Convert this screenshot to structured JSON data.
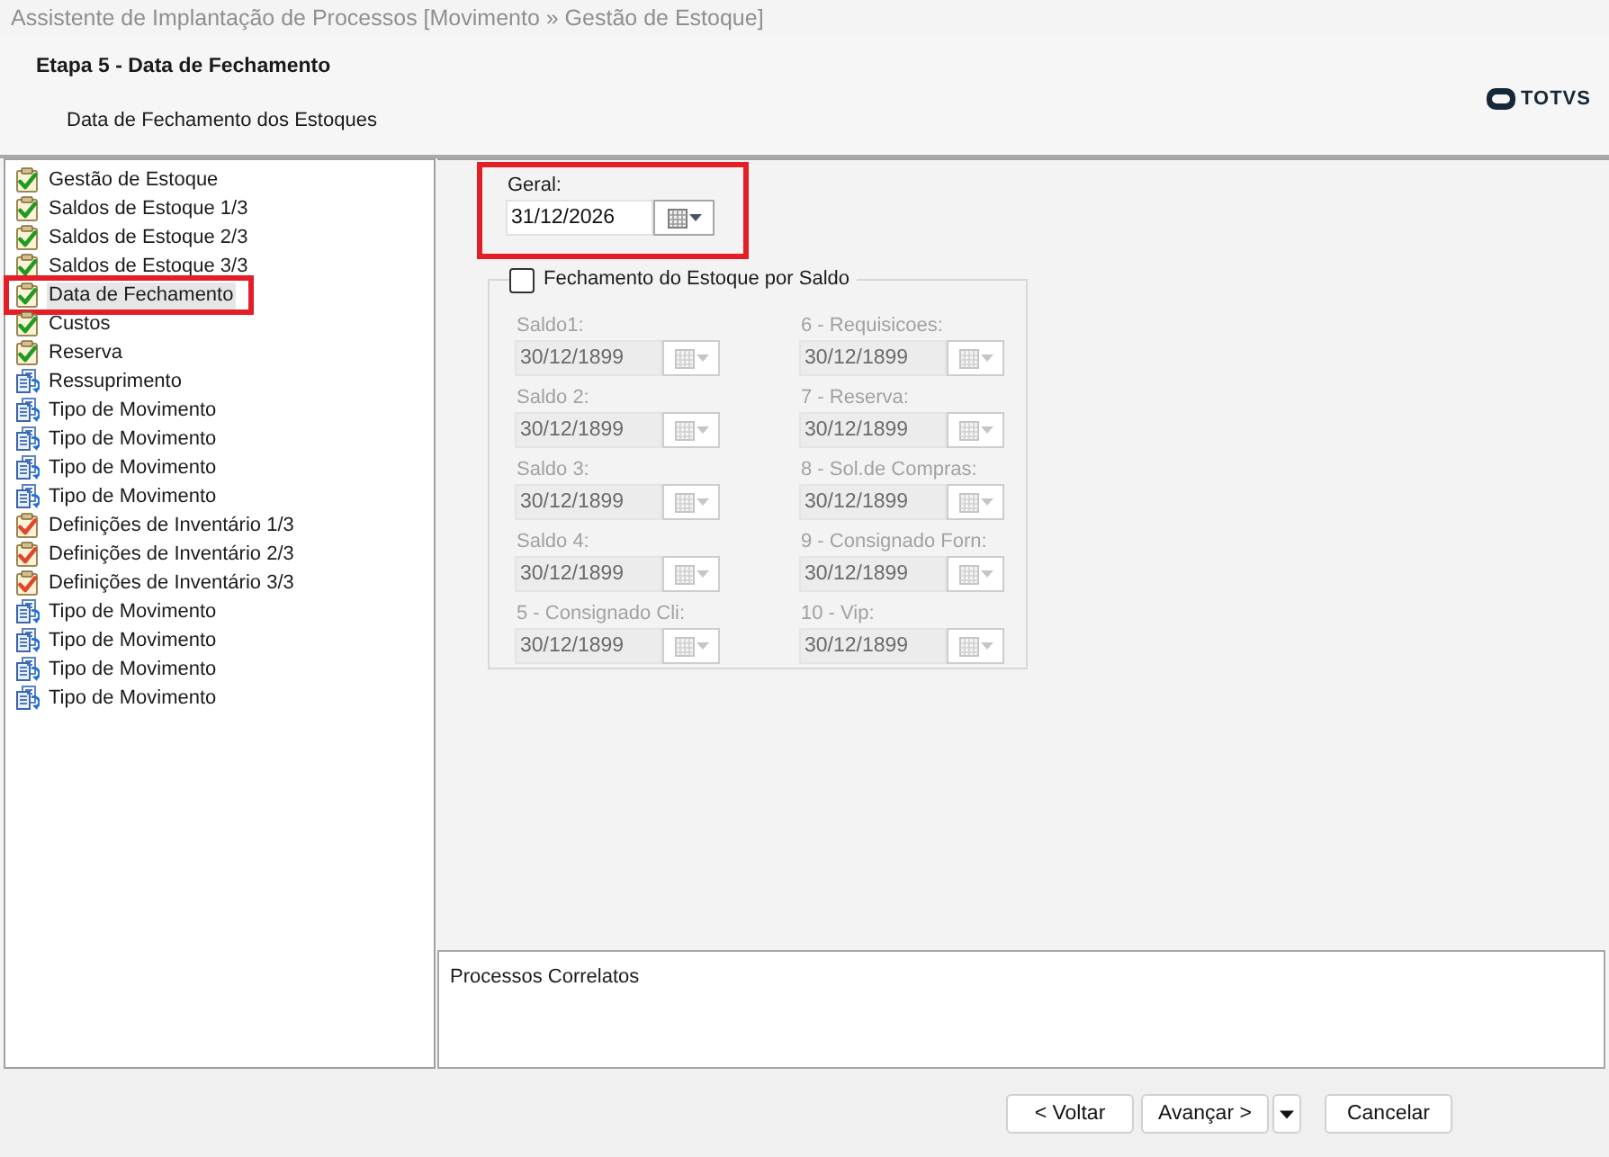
{
  "window": {
    "title": "Assistente de Implantação de Processos [Movimento » Gestão de Estoque]"
  },
  "header": {
    "step_title": "Etapa 5 - Data de Fechamento",
    "subtitle": "Data de Fechamento dos Estoques",
    "logo_text": "TOTVS"
  },
  "steps": [
    {
      "label": "Gestão de Estoque",
      "kind": "done",
      "selected": false,
      "marked": false
    },
    {
      "label": "Saldos de Estoque 1/3",
      "kind": "done",
      "selected": false,
      "marked": false
    },
    {
      "label": "Saldos de Estoque 2/3",
      "kind": "done",
      "selected": false,
      "marked": false
    },
    {
      "label": "Saldos de Estoque 3/3",
      "kind": "done",
      "selected": false,
      "marked": false
    },
    {
      "label": "Data de Fechamento",
      "kind": "done",
      "selected": true,
      "marked": true
    },
    {
      "label": "Custos",
      "kind": "done",
      "selected": false,
      "marked": false
    },
    {
      "label": "Reserva",
      "kind": "done",
      "selected": false,
      "marked": false
    },
    {
      "label": "Ressuprimento",
      "kind": "process",
      "selected": false,
      "marked": false
    },
    {
      "label": "Tipo de Movimento",
      "kind": "process",
      "selected": false,
      "marked": false
    },
    {
      "label": "Tipo de Movimento",
      "kind": "process",
      "selected": false,
      "marked": false
    },
    {
      "label": "Tipo de Movimento",
      "kind": "process",
      "selected": false,
      "marked": false
    },
    {
      "label": "Tipo de Movimento",
      "kind": "process",
      "selected": false,
      "marked": false
    },
    {
      "label": "Definições de Inventário 1/3",
      "kind": "pending",
      "selected": false,
      "marked": false
    },
    {
      "label": "Definições de Inventário 2/3",
      "kind": "pending",
      "selected": false,
      "marked": false
    },
    {
      "label": "Definições de Inventário 3/3",
      "kind": "pending",
      "selected": false,
      "marked": false
    },
    {
      "label": "Tipo de Movimento",
      "kind": "process",
      "selected": false,
      "marked": false
    },
    {
      "label": "Tipo de Movimento",
      "kind": "process",
      "selected": false,
      "marked": false
    },
    {
      "label": "Tipo de Movimento",
      "kind": "process",
      "selected": false,
      "marked": false
    },
    {
      "label": "Tipo de Movimento",
      "kind": "process",
      "selected": false,
      "marked": false
    }
  ],
  "general": {
    "label": "Geral:",
    "value": "31/12/2026",
    "disabled": false,
    "marked": true
  },
  "balance_group": {
    "label": "Fechamento do Estoque por Saldo",
    "checked": false,
    "fields": [
      {
        "label": "Saldo1:",
        "value": "30/12/1899",
        "disabled": true
      },
      {
        "label": "6 - Requisicoes:",
        "value": "30/12/1899",
        "disabled": true
      },
      {
        "label": "Saldo 2:",
        "value": "30/12/1899",
        "disabled": true
      },
      {
        "label": "7 - Reserva:",
        "value": "30/12/1899",
        "disabled": true
      },
      {
        "label": "Saldo 3:",
        "value": "30/12/1899",
        "disabled": true
      },
      {
        "label": "8 - Sol.de Compras:",
        "value": "30/12/1899",
        "disabled": true
      },
      {
        "label": "Saldo 4:",
        "value": "30/12/1899",
        "disabled": true
      },
      {
        "label": "9 - Consignado Forn:",
        "value": "30/12/1899",
        "disabled": true
      },
      {
        "label": "5 - Consignado Cli:",
        "value": "30/12/1899",
        "disabled": true
      },
      {
        "label": "10 - Vip:",
        "value": "30/12/1899",
        "disabled": true
      }
    ]
  },
  "related": {
    "title": "Processos Correlatos"
  },
  "buttons": [
    {
      "kind": "button",
      "label": "< Voltar"
    },
    {
      "kind": "button",
      "label": "Avançar >"
    },
    {
      "kind": "menu"
    },
    {
      "kind": "button",
      "label": "Cancelar"
    }
  ]
}
